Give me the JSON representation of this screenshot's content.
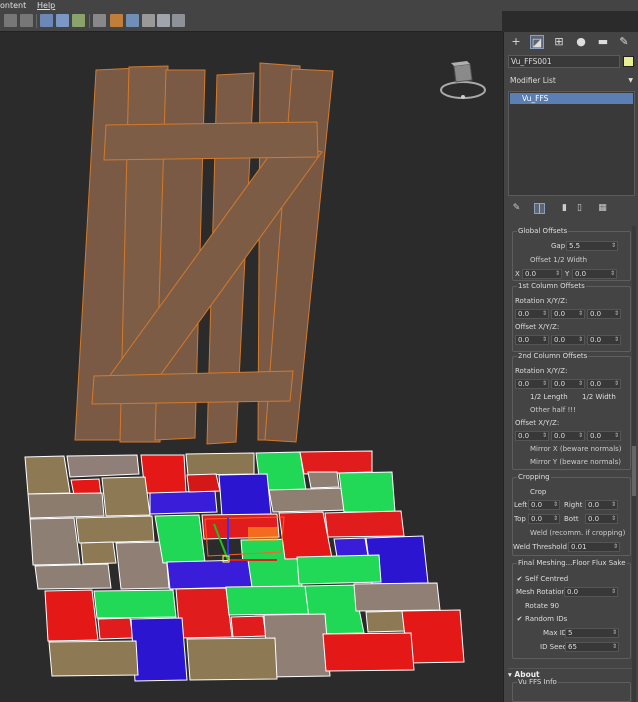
{
  "menubar": {
    "items": [
      "ontent",
      "Help"
    ]
  },
  "command_panel": {
    "tabs": [
      "create-tab",
      "modify-tab",
      "hierarchy-tab",
      "motion-tab",
      "display-tab",
      "utilities-tab"
    ],
    "object_name": "Vu_FFS001",
    "object_color": "#e8ef91",
    "modifier_list_label": "Modifier List",
    "stack_item": "Vu_FFS",
    "global_offsets": {
      "title": "Global Offsets",
      "gap_label": "Gap",
      "gap_value": "5.5",
      "offset_half_label": "Offset 1/2 Width",
      "x_label": "X",
      "x_value": "0.0",
      "y_label": "Y",
      "y_value": "0.0"
    },
    "first_column": {
      "title": "1st Column Offsets",
      "rotation_label": "Rotation X/Y/Z:",
      "rotation_values": [
        "0.0",
        "0.0",
        "0.0"
      ],
      "offset_label": "Offset X/Y/Z:",
      "offset_values": [
        "0.0",
        "0.0",
        "0.0"
      ]
    },
    "second_column": {
      "title": "2nd Column Offsets",
      "rotation_label": "Rotation X/Y/Z:",
      "rotation_values": [
        "0.0",
        "0.0",
        "0.0"
      ],
      "half_length_label": "1/2 Length",
      "half_width_label": "1/2 Width",
      "other_half_label": "Other half !!!",
      "offset_label": "Offset X/Y/Z:",
      "offset_values": [
        "0.0",
        "0.0",
        "0.0"
      ],
      "mirror_x_label": "Mirror X (beware normals)",
      "mirror_y_label": "Mirror Y (beware normals)"
    },
    "cropping": {
      "title": "Cropping",
      "crop_label": "Crop",
      "left_label": "Left",
      "left_value": "0.0",
      "right_label": "Right",
      "right_value": "0.0",
      "top_label": "Top",
      "top_value": "0.0",
      "bott_label": "Bott",
      "bott_value": "0.0",
      "weld_label": "Weld (recomm. if cropping)",
      "weld_threshold_label": "Weld Threshold",
      "weld_threshold_value": "0.01"
    },
    "final_meshing": {
      "title": "Final Meshing...Floor Flux Sake",
      "self_centred_label": "Self Centred",
      "self_centred_check": "✔",
      "mesh_rotation_label": "Mesh Rotation",
      "mesh_rotation_value": "0.0",
      "rotate90_label": "Rotate 90",
      "random_ids_label": "Random IDs",
      "random_ids_check": "✔",
      "max_id_label": "Max ID",
      "max_id_value": "5",
      "id_seed_label": "ID Seed",
      "id_seed_value": "65"
    },
    "about_label": "About",
    "vu_info_title": "Vu FFS Info"
  },
  "icons": {
    "spinner_arrows": "⇕"
  }
}
